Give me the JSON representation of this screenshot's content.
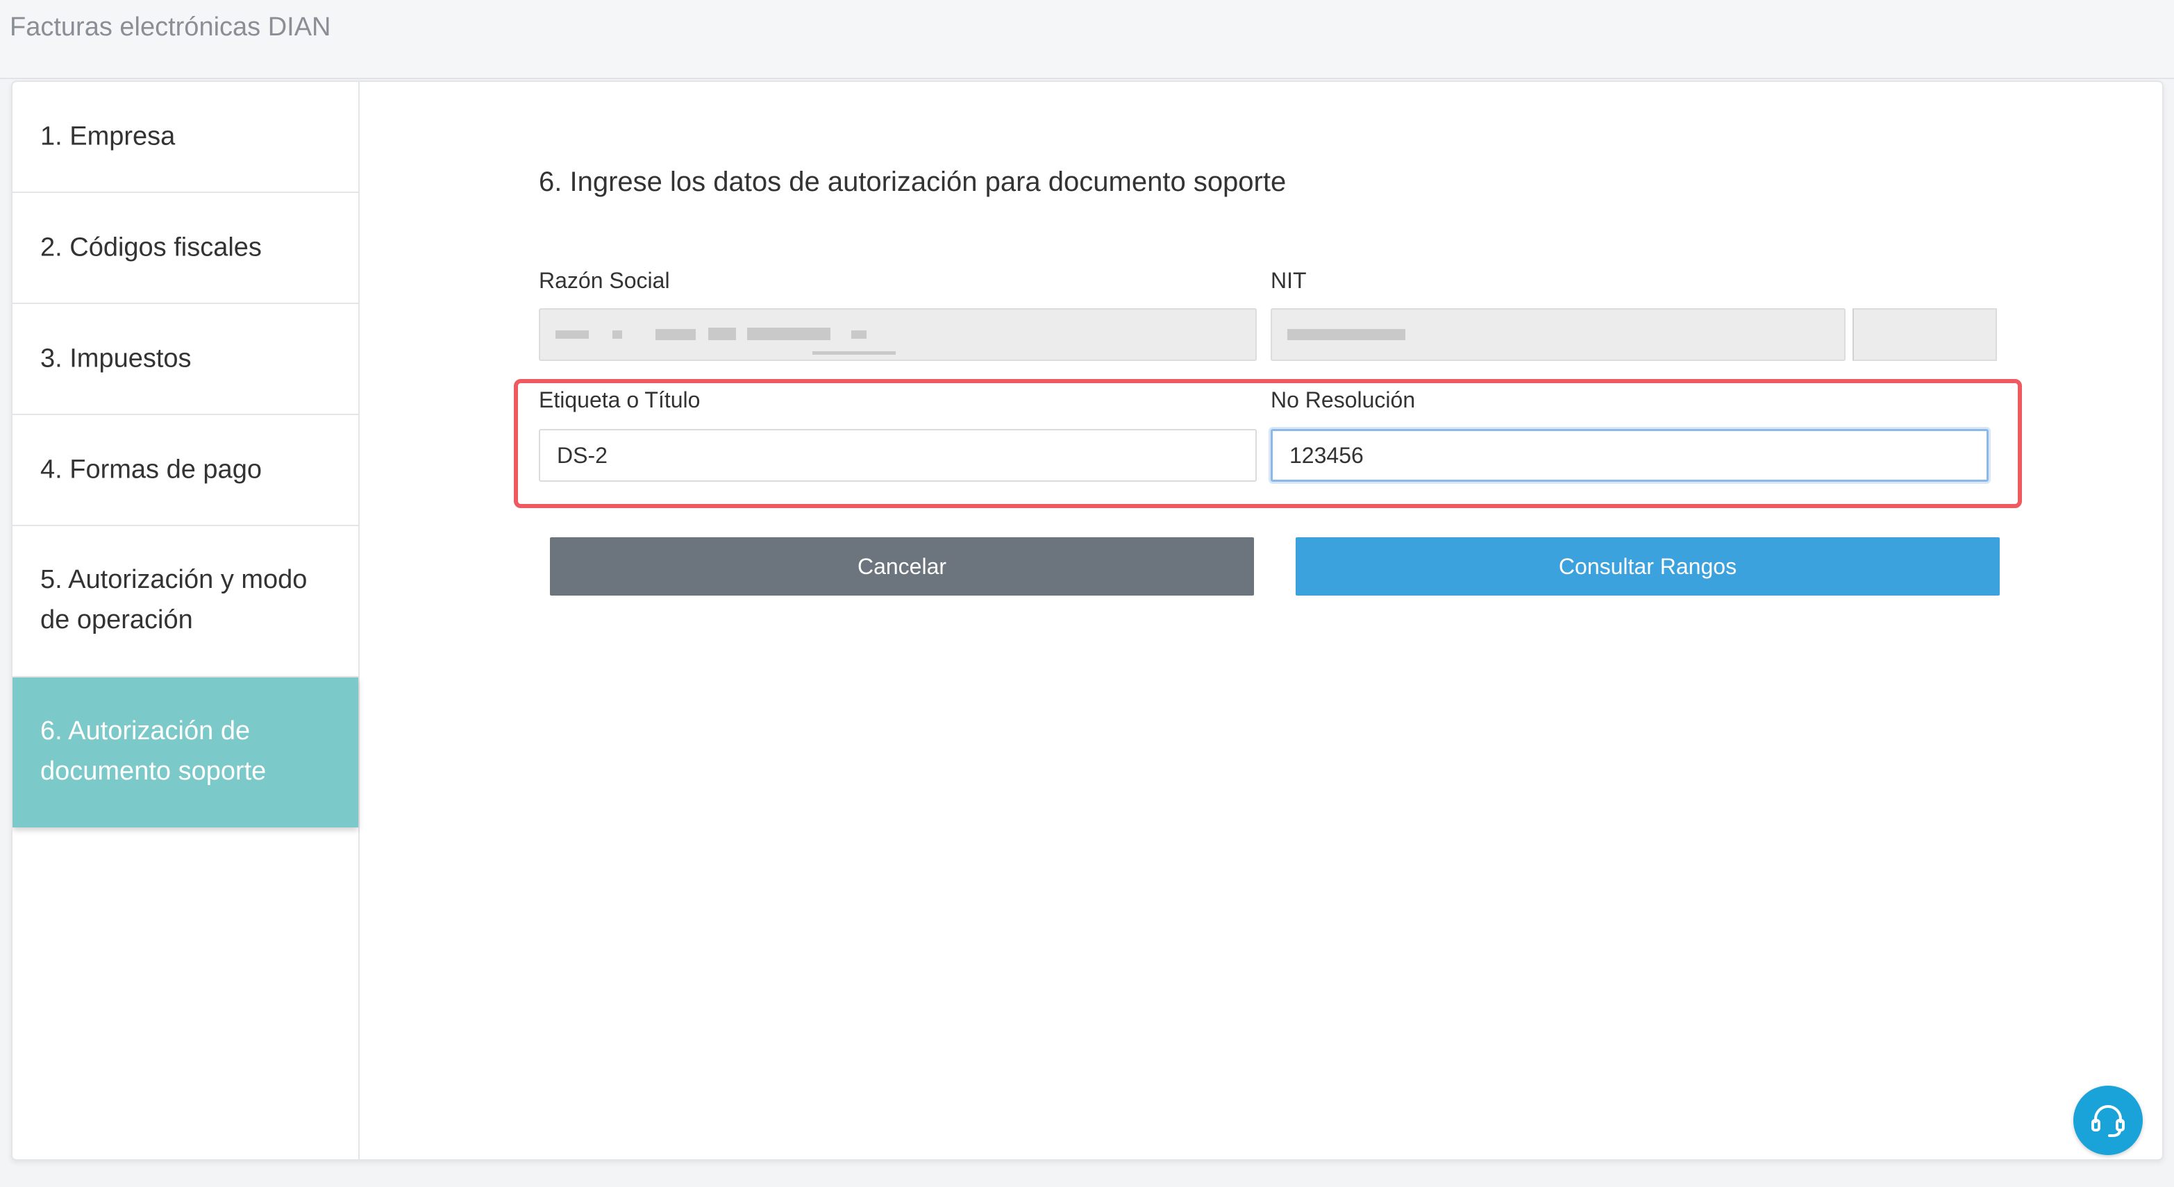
{
  "header": {
    "title": "Facturas electrónicas DIAN"
  },
  "sidebar": {
    "steps": [
      {
        "label": "1. Empresa"
      },
      {
        "label": "2. Códigos fiscales"
      },
      {
        "label": "3. Impuestos"
      },
      {
        "label": "4. Formas de pago"
      },
      {
        "label_line1": "5. Autorización y modo",
        "label_line2": "de operación"
      },
      {
        "label_line1": "6. Autorización de",
        "label_line2": "documento soporte",
        "active": true
      }
    ]
  },
  "main": {
    "section_title": "6. Ingrese los datos de autorización para documento soporte",
    "razon_social": {
      "label": "Razón Social"
    },
    "nit": {
      "label": "NIT"
    },
    "etiqueta": {
      "label": "Etiqueta o Título",
      "value": "DS-2"
    },
    "resolucion": {
      "label": "No Resolución",
      "value": "123456"
    },
    "buttons": {
      "cancel": "Cancelar",
      "primary": "Consultar Rangos"
    }
  },
  "colors": {
    "active_step": "#7cc9c9",
    "primary_button": "#3ba2dd",
    "cancel_button": "#6c757d",
    "highlight": "#ee5a5f",
    "support": "#1aa3d8"
  },
  "icons": {
    "support": "headset-icon"
  }
}
